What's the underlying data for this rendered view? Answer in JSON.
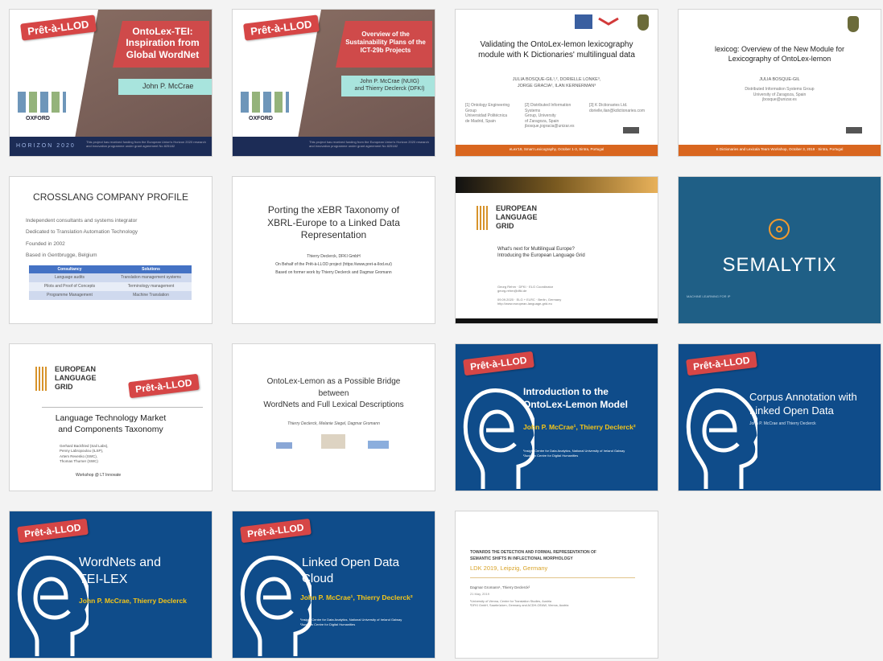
{
  "slides": [
    {
      "ribbon": "Prêt-à-LLOD",
      "title": "OntoLex-TEI:\nInspiration from\nGlobal WordNet",
      "author": "John P. McCrae",
      "footer": "This project has received funding from the European Union's Horizon 2020 research and innovation programme under grant agreement No 825182",
      "h2020": "HORIZON 2020"
    },
    {
      "ribbon": "Prêt-à-LLOD",
      "title": "Overview of the\nSustainability Plans of the\nICT-29b Projects",
      "author": "John P. McCrae (NUIG)\nand Thierry Declerck (DFKI)",
      "footer": "This project has received funding from the European Union's Horizon 2020 research and innovation programme under grant agreement No 825182"
    },
    {
      "title": "Validating the OntoLex-lemon lexicography\nmodule with K Dictionaries' multilingual data",
      "authors": "JULIA BOSQUE-GIL¹,², DORIELLE LONKE³,\nJORGE GRACIA², ILAN KERNERMAN³",
      "aff1": "[1] Ontology Engineering Group\nUniversidad Politécnica\nde Madrid, Spain",
      "aff2": "[2] Distributed Information Systems\nGroup, University\nof Zaragoza, Spain\njbosque,jogracia@unizar.es",
      "aff3": "[3] K Dictionaries Ltd.\ndorielle,ilan@kdictionaries.com",
      "footer": "eLex'19, Smart Lexicography, October 1-3, Sintra, Portugal"
    },
    {
      "title": "lexicog: Overview of the New Module for\nLexicography of OntoLex-lemon",
      "author": "JULIA BOSQUE-GIL",
      "aff": "Distributed Information Systems Group\nUniversity of Zaragoza, Spain\njbosque@unizar.es",
      "footer": "K Dictionaries and Lexicala Team Workshop, October 3, 2019 · Sintra, Portugal"
    },
    {
      "title": "CROSSLANG COMPANY PROFILE",
      "bullets": [
        "Independent consultants and systems integrator",
        "Dedicated to Translation Automation Technology",
        "Founded in 2002",
        "Based in Gentbrugge, Belgium"
      ],
      "table_headers": [
        "Consultancy",
        "Solutions"
      ],
      "table_rows": [
        [
          "Language audits",
          "Translation management systems"
        ],
        [
          "Pilots and Proof of Concepts",
          "Terminology management"
        ],
        [
          "Programme Management",
          "Machine Translation"
        ]
      ]
    },
    {
      "title": "Porting the xEBR Taxonomy of\nXBRL-Europe to a Linked Data\nRepresentation",
      "line1": "Thierry Declerck, DFKI GmbH",
      "line2": "On Behalf of the Prêt-à-LLOD project (https://www.pret-a-llod.eu/)",
      "line3": "Based on former work by Thierry Declerck and Dagmar Gromann"
    },
    {
      "logo": "EUROPEAN\nLANGUAGE\nGRID",
      "subtitle": "What's next for Multilingual Europe?\nIntroducing the European Language Grid",
      "small": "Georg Rehm · DFKI · ELG Coordinator\ngeorg.rehm@dfki.de\n\n09.09.2020 · ELG + ELRC · Berlin, Germany\nhttp://www.european-language-grid.eu"
    },
    {
      "brand": "SEMALYTIX",
      "small": "MACHINE LEARNING FOR IP"
    },
    {
      "logo": "EUROPEAN\nLANGUAGE\nGRID",
      "ribbon": "Prêt-à-LLOD",
      "title": "Language Technology Market\nand Components Taxonomy",
      "people": "Gerhard Backfried (Sail Labs),\nPenny Labropoulou (ILSP),\nArtem Revenko (SWC),\nThomas Thurner (SWC)",
      "event": "Workshop @ LT Innovate"
    },
    {
      "title": "OntoLex-Lemon as a Possible Bridge\nbetween\nWordNets and Full Lexical Descriptions",
      "authors": "Thierry Declerck, Melanie Siegel, Dagmar Gromann"
    },
    {
      "ribbon": "Prêt-à-LLOD",
      "title": "Introduction to the\nOntoLex-Lemon Model",
      "author": "John P. McCrae¹, Thierry Declerck²",
      "aff": "¹Insight Centre for Data Analytics, National University of Ireland Galway\n²Austrian Centre for Digital Humanities"
    },
    {
      "ribbon": "Prêt-à-LLOD",
      "title": "Corpus Annotation with\nLinked Open Data",
      "author": "John P. McCrae and Thierry Declerck"
    },
    {
      "ribbon": "Prêt-à-LLOD",
      "title": "WordNets and\nTEI-LEX",
      "author": "John P. McCrae, Thierry Declerck"
    },
    {
      "ribbon": "Prêt-à-LLOD",
      "title": "Linked Open Data\nCloud",
      "author": "John P. McCrae¹, Thierry Declerck²",
      "aff": "¹Insight Centre for Data Analytics, National University of Ireland Galway\n²Austrian Centre for Digital Humanities"
    },
    {
      "title": "TOWARDS THE DETECTION AND FORMAL REPRESENTATION OF\nSEMANTIC SHIFTS IN INFLECTIONAL MORPHOLOGY",
      "event": "LDK 2019, Leipzig, Germany",
      "authors": "Dagmar Gromann¹, Thierry Declerck²",
      "date": "21 May, 2019",
      "aff": "¹University of Vienna, Centre for Translation Studies, Austria\n²DFKI GmbH, Saarbrücken, Germany and ACDH-OEAW, Vienna, Austria"
    }
  ],
  "colors": {
    "red": "#d64646",
    "blue": "#0f4c8a",
    "orange": "#d9661f",
    "teal": "#1f5f86",
    "semalytix_orange": "#f29a2e"
  }
}
